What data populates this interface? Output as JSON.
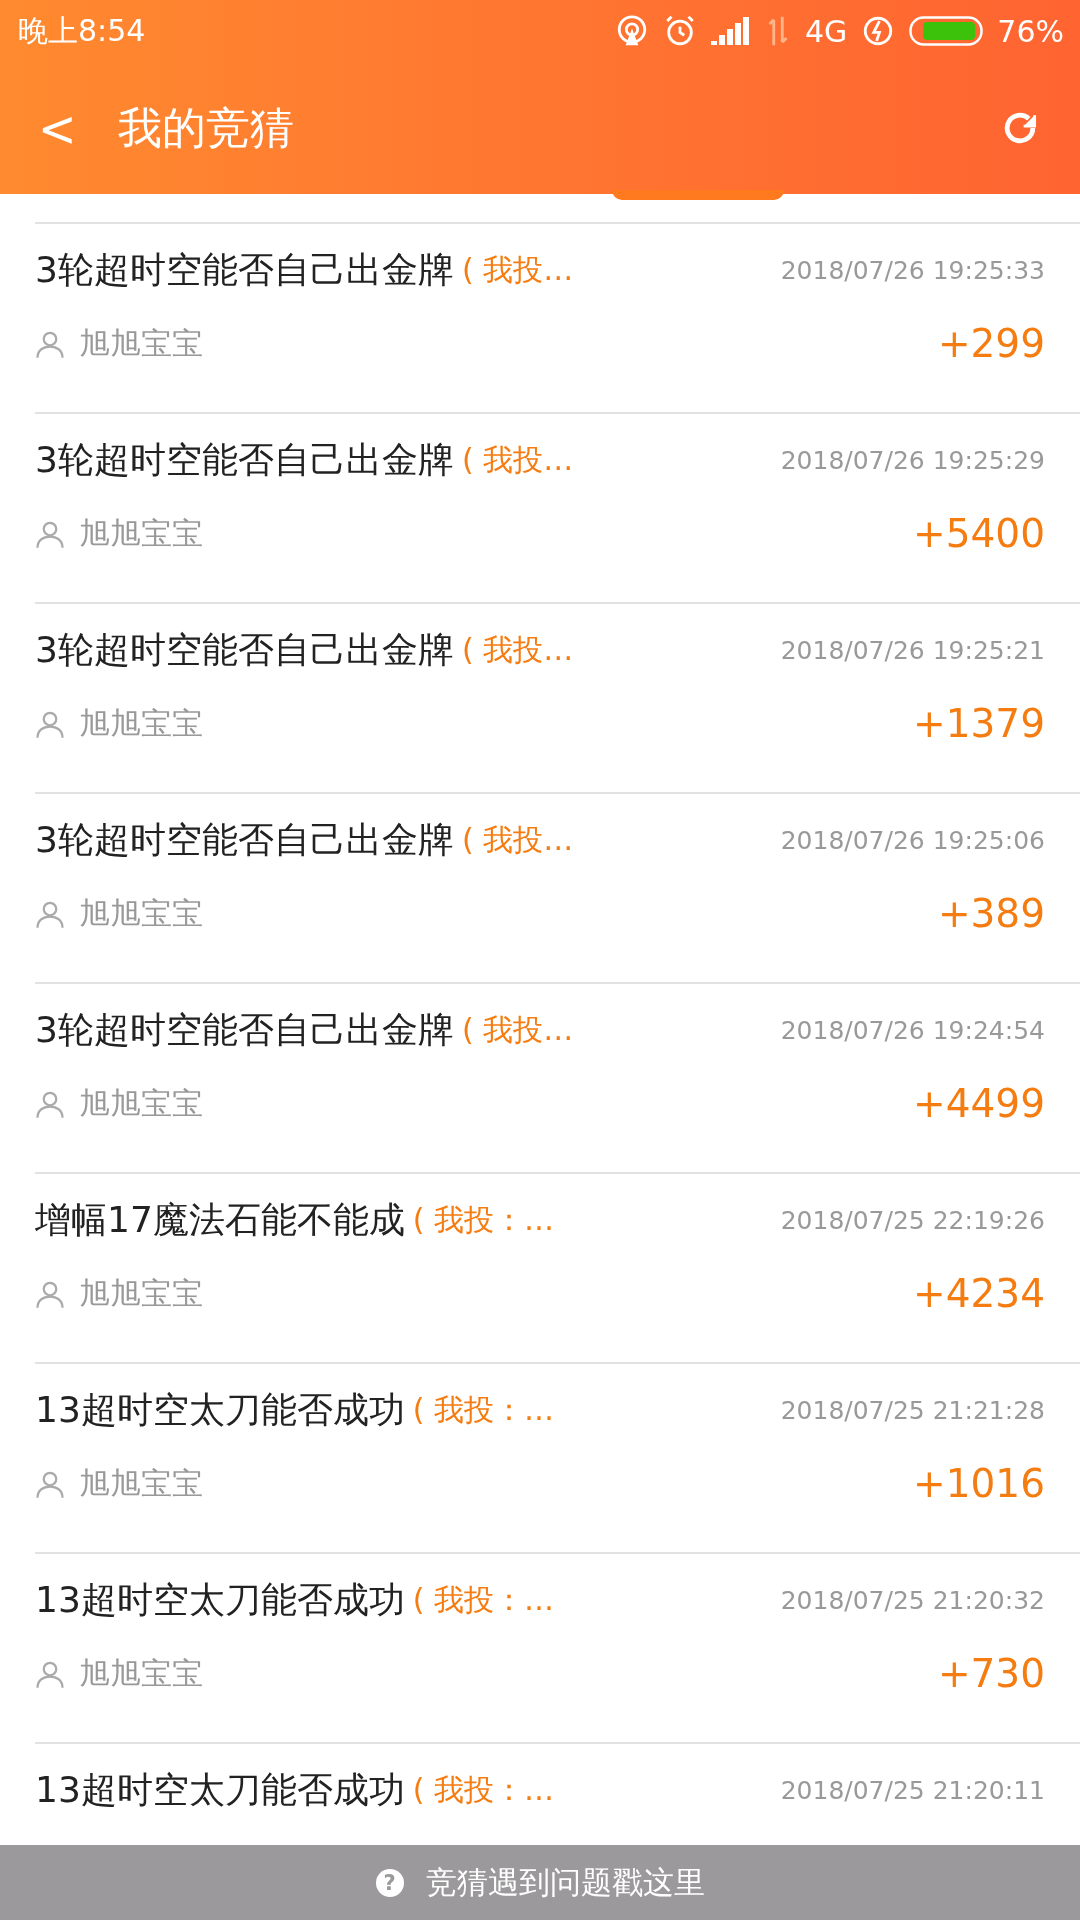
{
  "status_bar": {
    "time": "晚上8:54",
    "network": "4G",
    "battery": "76%"
  },
  "header": {
    "back": "<",
    "title": "我的竞猜"
  },
  "bets": [
    {
      "title": "3轮超时空能否自己出金牌",
      "vote": "( 我投…",
      "time": "2018/07/26 19:25:33",
      "user": "旭旭宝宝",
      "amount": "+299"
    },
    {
      "title": "3轮超时空能否自己出金牌",
      "vote": "( 我投…",
      "time": "2018/07/26 19:25:29",
      "user": "旭旭宝宝",
      "amount": "+5400"
    },
    {
      "title": "3轮超时空能否自己出金牌",
      "vote": "( 我投…",
      "time": "2018/07/26 19:25:21",
      "user": "旭旭宝宝",
      "amount": "+1379"
    },
    {
      "title": "3轮超时空能否自己出金牌",
      "vote": "( 我投…",
      "time": "2018/07/26 19:25:06",
      "user": "旭旭宝宝",
      "amount": "+389"
    },
    {
      "title": "3轮超时空能否自己出金牌",
      "vote": "( 我投…",
      "time": "2018/07/26 19:24:54",
      "user": "旭旭宝宝",
      "amount": "+4499"
    },
    {
      "title": "增幅17魔法石能不能成",
      "vote": "( 我投：…",
      "time": "2018/07/25 22:19:26",
      "user": "旭旭宝宝",
      "amount": "+4234"
    },
    {
      "title": "13超时空太刀能否成功",
      "vote": "( 我投：…",
      "time": "2018/07/25 21:21:28",
      "user": "旭旭宝宝",
      "amount": "+1016"
    },
    {
      "title": "13超时空太刀能否成功",
      "vote": "( 我投：…",
      "time": "2018/07/25 21:20:32",
      "user": "旭旭宝宝",
      "amount": "+730"
    },
    {
      "title": "13超时空太刀能否成功",
      "vote": "( 我投：…",
      "time": "2018/07/25 21:20:11"
    }
  ],
  "help_bar": {
    "icon": "?",
    "label": "竞猜遇到问题戳这里"
  }
}
